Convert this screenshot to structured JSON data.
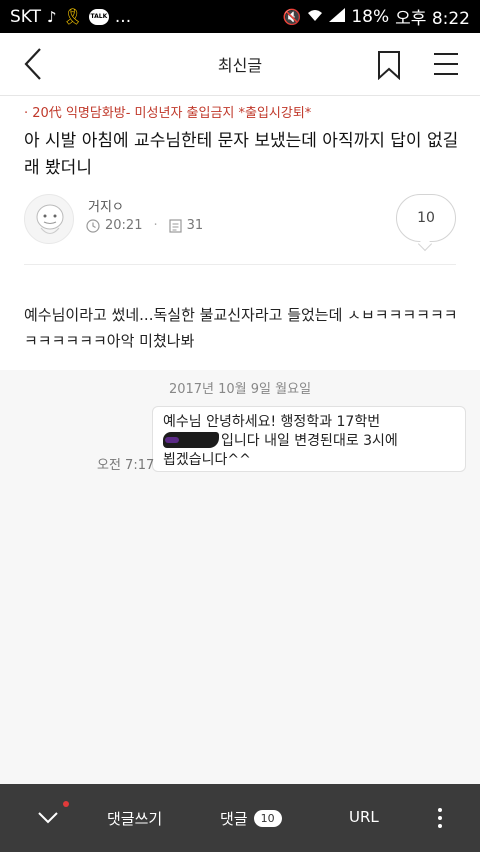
{
  "status_bar": {
    "carrier": "SKT",
    "notif_more": "...",
    "talk_label": "TALK",
    "battery": "18%",
    "time": "오후 8:22"
  },
  "header": {
    "title": "최신글"
  },
  "post": {
    "board": "· 20代 익명담화방- 미성년자 출입금지 *출입시강퇴*",
    "title": "아 시발 아침에 교수님한테 문자 보냈는데 아직까지 답이 없길래 봤더니",
    "author": "거지ㅇ",
    "time": "20:21",
    "views": "31",
    "comment_count": "10",
    "body": "예수님이라고 썼네...독실한 불교신자라고 들었는데 ㅅㅂㅋㅋㅋㅋㅋㅋㅋㅋㅋㅋㅋㅋ아악 미쳤나봐"
  },
  "embedded_sms": {
    "date": "2017년 10월 9일 월요일",
    "lines": [
      "예수님 안녕하세요! 행정학과 17학번",
      "입니다 내일 변경된대로 3시에",
      "뵙겠습니다^^"
    ],
    "time": "오전 7:17"
  },
  "bottom_bar": {
    "write_label": "댓글쓰기",
    "comment_label": "댓글",
    "comment_badge": "10",
    "url_label": "URL"
  },
  "colors": {
    "accent_red": "#c0392b",
    "bottom_bar_bg": "#3b3b3b"
  },
  "icons": [
    "back-icon",
    "bookmark-icon",
    "hamburger-menu-icon",
    "clock-icon",
    "document-icon",
    "chevron-down-icon",
    "more-vertical-icon"
  ]
}
